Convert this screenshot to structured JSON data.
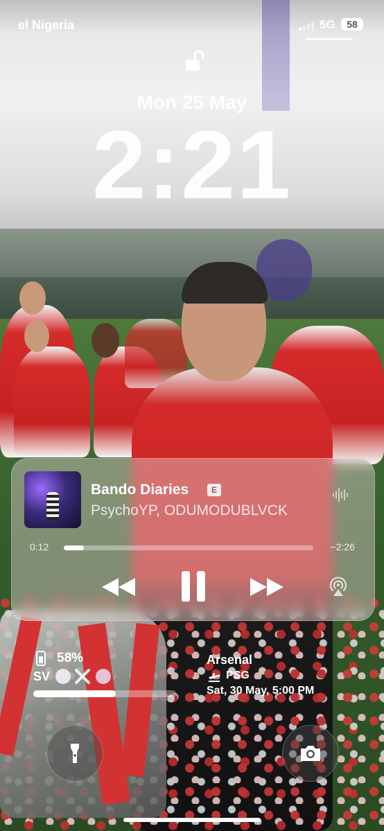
{
  "status_bar": {
    "carrier": "el Nigeria",
    "network": "5G",
    "battery": "58"
  },
  "lock_screen": {
    "date": "Mon 25 May",
    "time": "2:21"
  },
  "now_playing": {
    "title": "Bando Diaries",
    "explicit_badge": "E",
    "artist": "PsychoYP, ODUMODUBLVCK",
    "elapsed": "0:12",
    "remaining": "−2:26",
    "progress_fraction": 0.08,
    "controls": {
      "rewind_icon": "rewind-icon",
      "pause_icon": "pause-icon",
      "forward_icon": "fast-forward-icon",
      "airplay_icon": "airplay-icon"
    }
  },
  "widgets": {
    "battery": {
      "percent": "58%",
      "label": "SV",
      "level_fraction": 0.58
    },
    "football": {
      "home_team": "Arsenal",
      "away_team": "PSG",
      "kickoff": "Sat, 30 May, 5:00 PM"
    }
  },
  "quick_actions": {
    "left_icon": "flashlight-icon",
    "right_icon": "camera-icon"
  },
  "colors": {
    "accent_red": "#d42a2a",
    "glass_tint": "#e1cdcd"
  }
}
